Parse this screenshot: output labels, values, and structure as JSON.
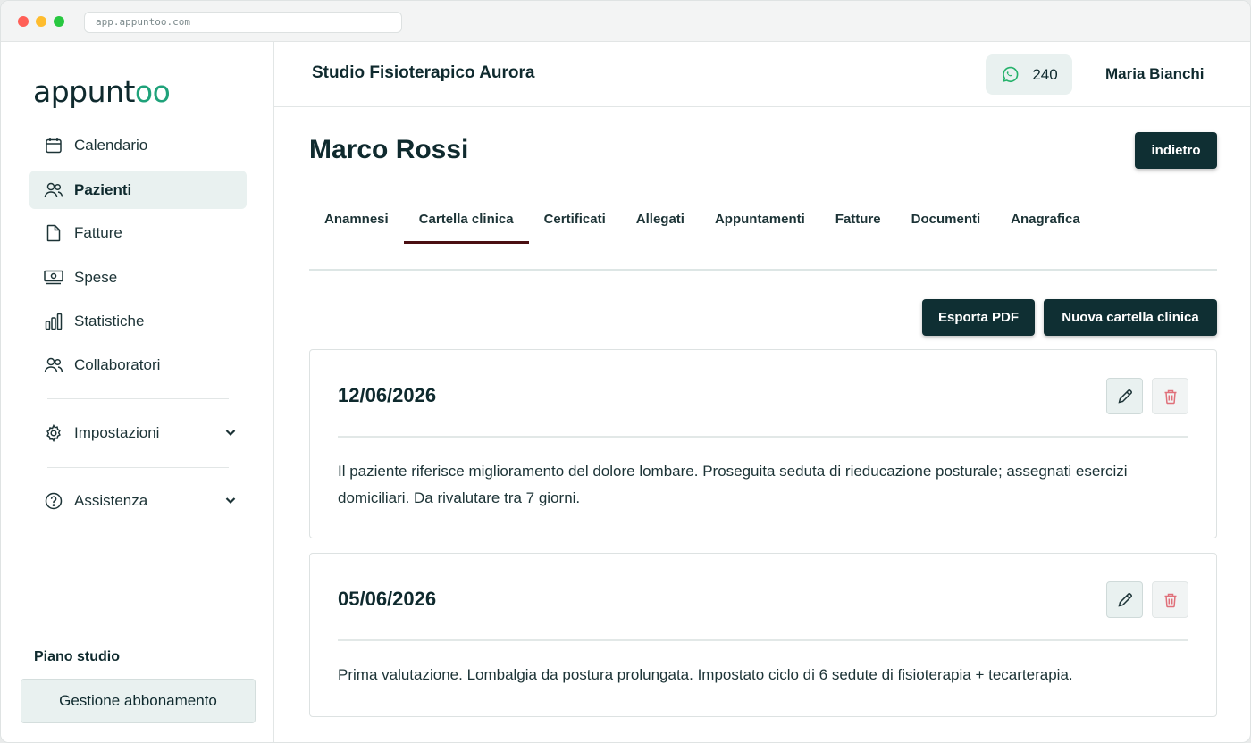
{
  "browser": {
    "url": "app.appuntoo.com"
  },
  "sidebar": {
    "logo": {
      "prefix": "appunt",
      "highlight": "oo"
    },
    "items": [
      {
        "label": "Calendario",
        "icon": "calendar-icon"
      },
      {
        "label": "Pazienti",
        "icon": "users-icon",
        "active": true
      },
      {
        "label": "Fatture",
        "icon": "document-icon"
      },
      {
        "label": "Spese",
        "icon": "cash-icon"
      },
      {
        "label": "Statistiche",
        "icon": "bar-chart-icon"
      },
      {
        "label": "Collaboratori",
        "icon": "users-icon"
      }
    ],
    "settings": {
      "label": "Impostazioni",
      "icon": "gear-icon"
    },
    "help": {
      "label": "Assistenza",
      "icon": "question-circle-icon"
    },
    "plan_label": "Piano studio",
    "plan_button": "Gestione abbonamento"
  },
  "header": {
    "studio_name": "Studio Fisioterapico Aurora",
    "whatsapp_count": "240",
    "user_name": "Maria Bianchi"
  },
  "patient": {
    "name": "Marco Rossi",
    "back_button": "indietro"
  },
  "tabs": [
    {
      "label": "Anamnesi"
    },
    {
      "label": "Cartella clinica",
      "active": true
    },
    {
      "label": "Certificati"
    },
    {
      "label": "Allegati"
    },
    {
      "label": "Appuntamenti"
    },
    {
      "label": "Fatture"
    },
    {
      "label": "Documenti"
    },
    {
      "label": "Anagrafica"
    }
  ],
  "actions": {
    "export_pdf": "Esporta PDF",
    "new_record": "Nuova cartella clinica"
  },
  "records": [
    {
      "date": "12/06/2026",
      "text": "Il paziente riferisce miglioramento del dolore lombare. Proseguita seduta di rieducazione posturale; assegnati esercizi domiciliari. Da rivalutare tra 7 giorni."
    },
    {
      "date": "05/06/2026",
      "text": "Prima valutazione. Lombalgia da postura prolungata. Impostato ciclo di 6 sedute di fisioterapia + tecarterapia."
    }
  ],
  "colors": {
    "primary_dark": "#0f2f33",
    "accent_green": "#1fa27a",
    "active_tab_underline": "#4a0f12",
    "delete_icon": "#e0707a",
    "whatsapp": "#25b26b"
  }
}
